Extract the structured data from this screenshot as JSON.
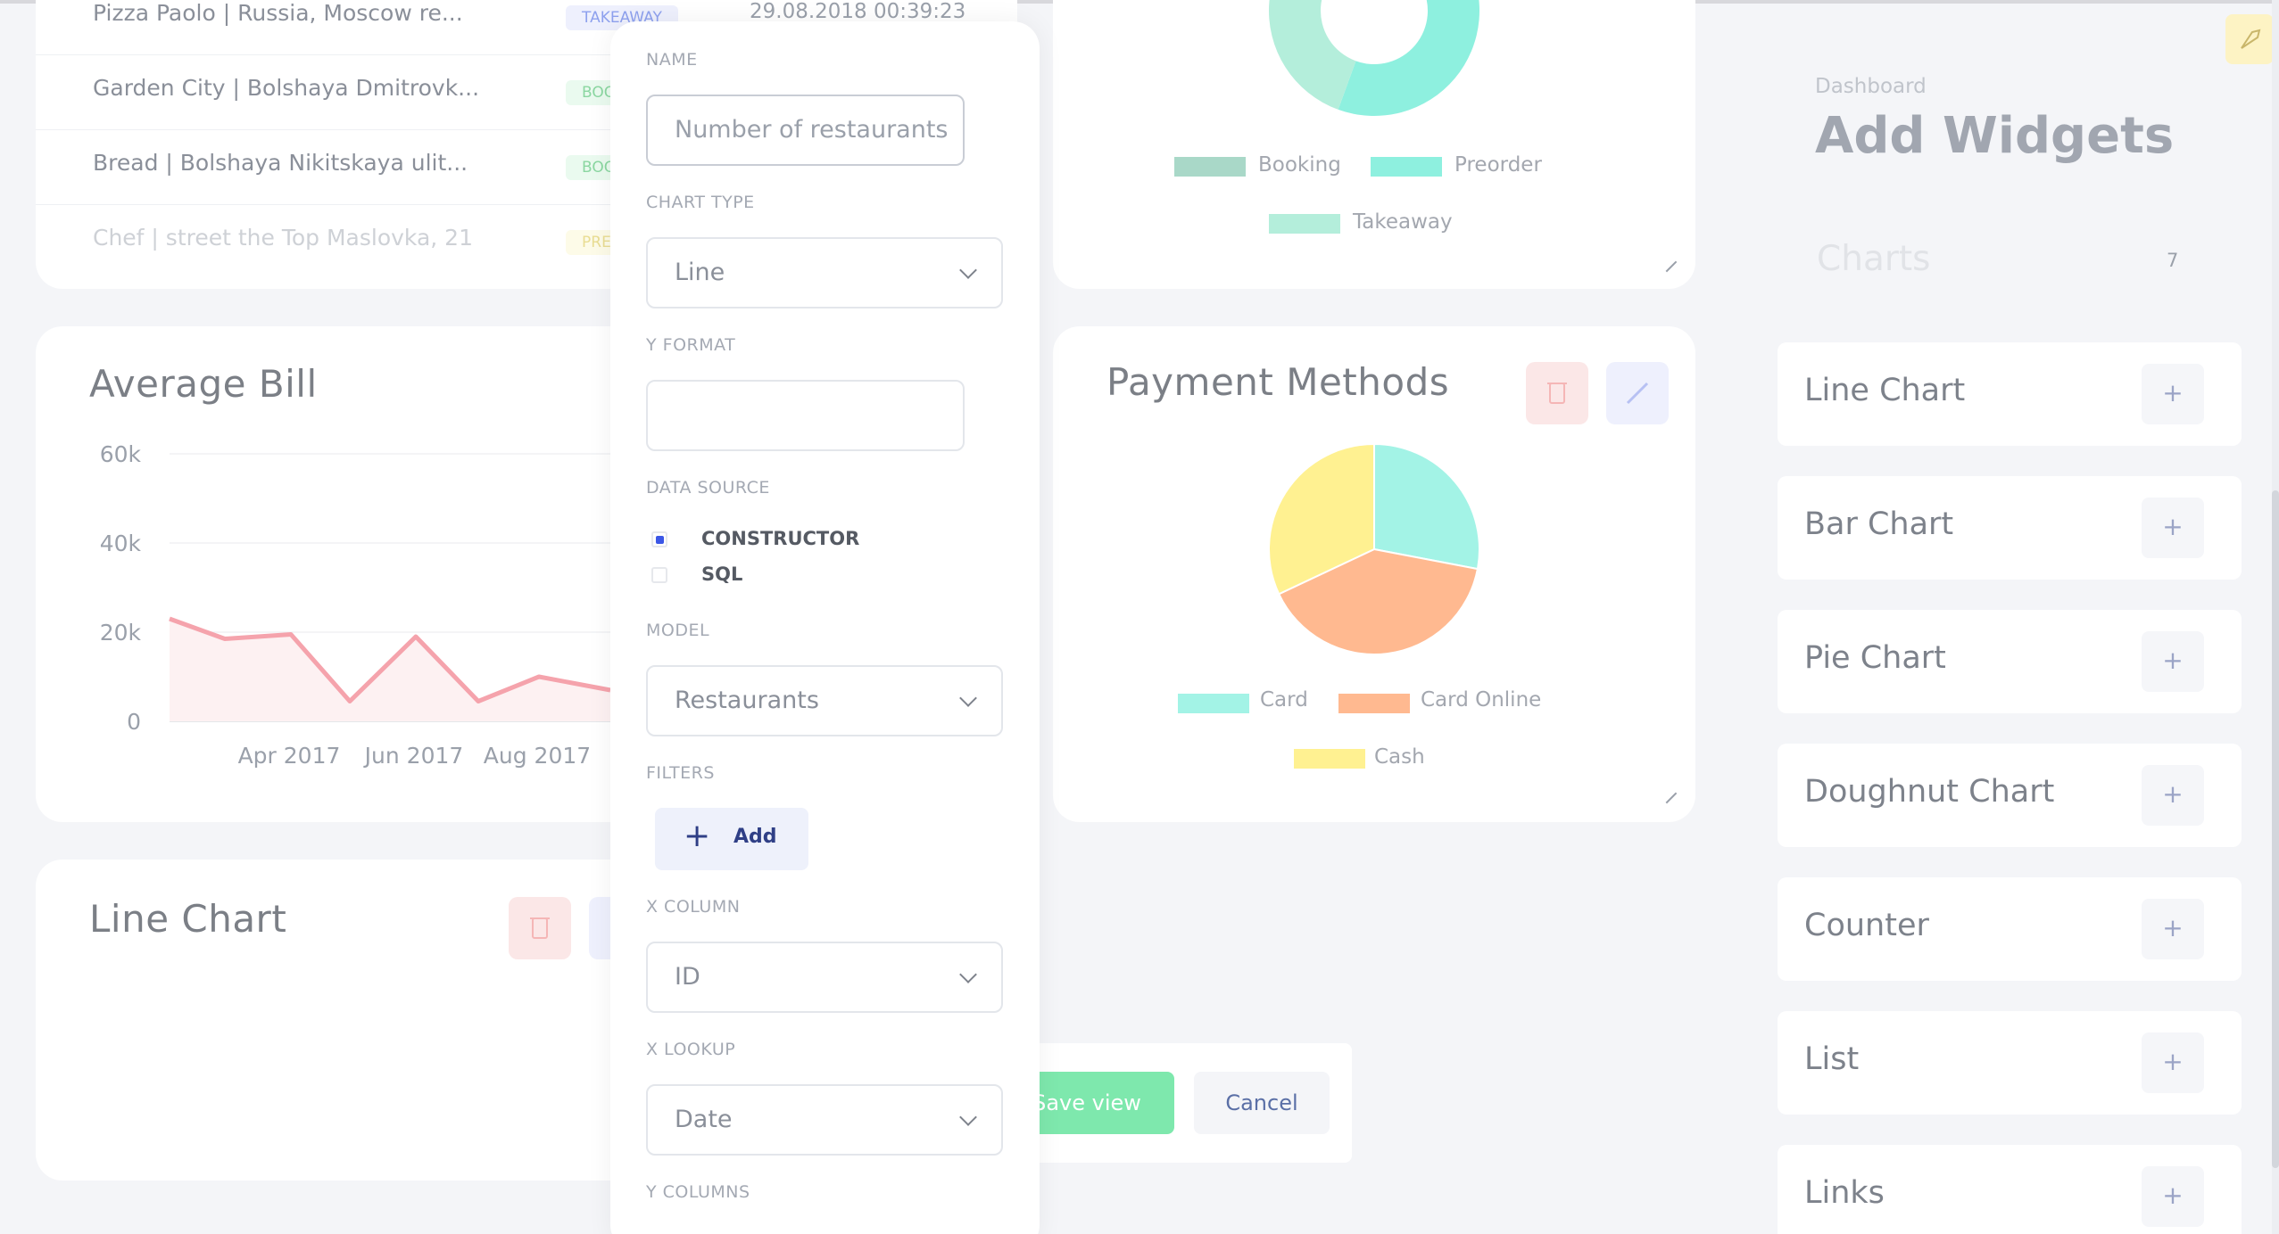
{
  "table": {
    "rows": [
      {
        "name": "Pizza Paolo | Russia, Moscow re...",
        "badge": "TAKEAWAY",
        "date": "29.08.2018 00:39:23"
      },
      {
        "name": "Garden City | Bolshaya Dmitrovk...",
        "badge": "BOO",
        "date": ""
      },
      {
        "name": "Bread | Bolshaya Nikitskaya ulit...",
        "badge": "BOO",
        "date": ""
      },
      {
        "name": "Chef | street the Top Maslovka, 21",
        "badge": "PRE",
        "date": ""
      }
    ]
  },
  "average_bill": {
    "title": "Average Bill",
    "chart_data": {
      "type": "line",
      "y_ticks": [
        "60k",
        "40k",
        "20k",
        "0"
      ],
      "x_ticks": [
        "Apr 2017",
        "Jun 2017",
        "Aug 2017"
      ],
      "ylim": [
        0,
        60000
      ],
      "values": [
        23000,
        18500,
        19500,
        4500,
        19000,
        4500,
        10000,
        7000
      ],
      "color": "#f5a3ac"
    }
  },
  "line_chart_card": {
    "title": "Line Chart"
  },
  "doughnut_card": {
    "legend": [
      "Booking",
      "Preorder",
      "Takeaway"
    ],
    "colors": [
      "#a9d8c8",
      "#8ef0df",
      "#b4eedb"
    ]
  },
  "payment_methods": {
    "title": "Payment Methods",
    "chart_data": {
      "type": "pie",
      "labels": [
        "Card",
        "Card Online",
        "Cash"
      ],
      "values": [
        28,
        40,
        32
      ],
      "colors": [
        "#a3f3e6",
        "#ffb990",
        "#fff191"
      ]
    }
  },
  "form": {
    "name_label": "NAME",
    "name_value": "Number of restaurants",
    "chart_type_label": "CHART TYPE",
    "chart_type_value": "Line",
    "y_format_label": "Y FORMAT",
    "y_format_value": "",
    "data_source_label": "DATA SOURCE",
    "data_source_options": [
      "CONSTRUCTOR",
      "SQL"
    ],
    "data_source_selected": "CONSTRUCTOR",
    "model_label": "MODEL",
    "model_value": "Restaurants",
    "filters_label": "FILTERS",
    "add_filter_label": "Add",
    "x_column_label": "X COLUMN",
    "x_column_value": "ID",
    "x_lookup_label": "X LOOKUP",
    "x_lookup_value": "Date",
    "y_columns_label": "Y COLUMNS"
  },
  "actions": {
    "save_label": "Save view",
    "cancel_label": "Cancel"
  },
  "sidebar": {
    "breadcrumb": "Dashboard",
    "title": "Add Widgets",
    "section": "Charts",
    "section_count": "7",
    "widgets": [
      {
        "label": "Line Chart"
      },
      {
        "label": "Bar Chart"
      },
      {
        "label": "Pie Chart"
      },
      {
        "label": "Doughnut Chart"
      },
      {
        "label": "Counter"
      },
      {
        "label": "List"
      },
      {
        "label": "Links"
      }
    ],
    "plus_symbol": "+"
  },
  "accent": {
    "primary": "#3b57e6",
    "success": "#7ee8ad",
    "danger": "#fbe7e7",
    "edit": "#eef0fd"
  }
}
